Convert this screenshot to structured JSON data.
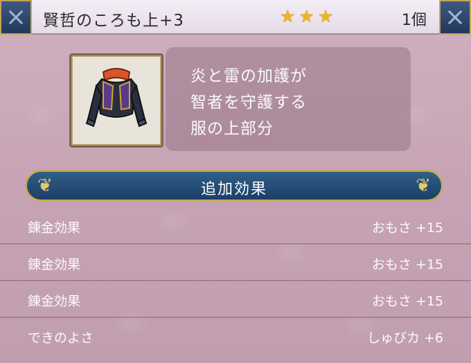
{
  "header": {
    "item_name": "賢哲のころも上+3",
    "star_count": 3,
    "star_color": "#f0b51e",
    "quantity": "1個"
  },
  "item": {
    "image_icon": "jacket-icon",
    "description": [
      "炎と雷の加護が",
      "智者を守護する",
      "服の上部分"
    ]
  },
  "section": {
    "title": "追加効果"
  },
  "effects": [
    {
      "label": "錬金効果",
      "value": "おもさ +15"
    },
    {
      "label": "錬金効果",
      "value": "おもさ +15"
    },
    {
      "label": "錬金効果",
      "value": "おもさ +15"
    },
    {
      "label": "できのよさ",
      "value": "しゅびカ +6"
    }
  ]
}
